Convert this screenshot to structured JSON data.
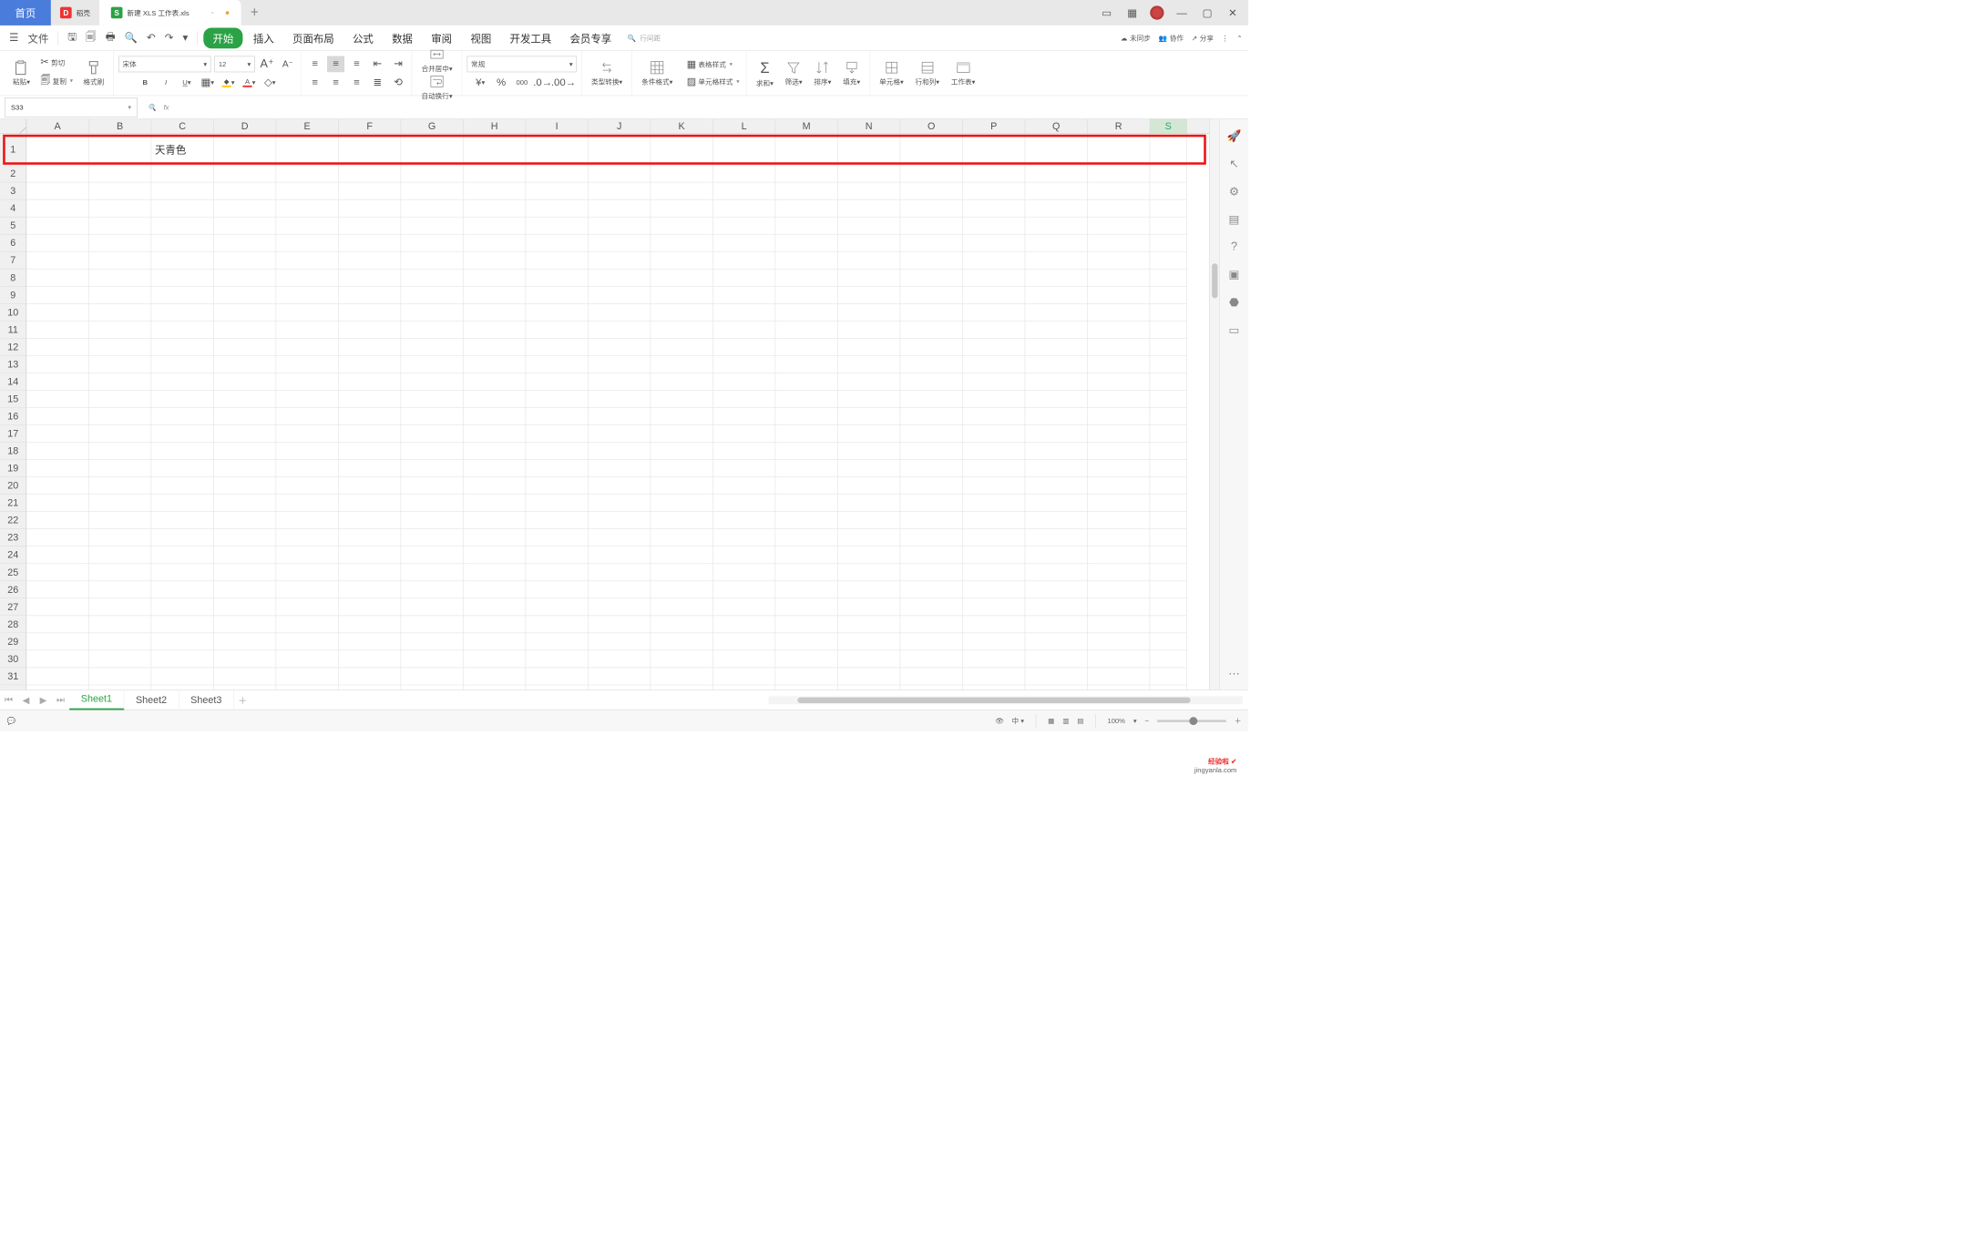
{
  "titlebar": {
    "home": "首页",
    "doke": "稻壳",
    "doc": "新建 XLS 工作表.xls",
    "add": "+"
  },
  "menubar": {
    "file": "文件",
    "tabs": [
      "开始",
      "插入",
      "页面布局",
      "公式",
      "数据",
      "审阅",
      "视图",
      "开发工具",
      "会员专享"
    ],
    "active": 0,
    "search_placeholder": "行间距",
    "right": {
      "unsync": "未同步",
      "collab": "协作",
      "share": "分享"
    }
  },
  "ribbon": {
    "paste": "粘贴",
    "cut": "剪切",
    "copy": "复制",
    "brush": "格式刷",
    "font_name": "宋体",
    "font_size": "12",
    "number_format": "常规",
    "merge": "合并居中",
    "wrap": "自动换行",
    "type": "类型转换",
    "cond": "条件格式",
    "tablestyle": "表格样式",
    "cellstyle": "单元格样式",
    "sum": "求和",
    "filter": "筛选",
    "sort": "排序",
    "fill": "填充",
    "cellgroup": "单元格",
    "rowcol": "行和列",
    "worksheet": "工作表"
  },
  "namebox": "S33",
  "fx": "fx",
  "cols": [
    "A",
    "B",
    "C",
    "D",
    "E",
    "F",
    "G",
    "H",
    "I",
    "J",
    "K",
    "L",
    "M",
    "N",
    "O",
    "P",
    "Q",
    "R",
    "S"
  ],
  "selectedCol": "S",
  "rows": 32,
  "cell_c1": "天青色",
  "sheets": [
    "Sheet1",
    "Sheet2",
    "Sheet3"
  ],
  "activeSheet": 0,
  "status": {
    "zoom": "100%"
  },
  "watermark": {
    "main": "经验啦",
    "sub": "jingyanla.com"
  }
}
